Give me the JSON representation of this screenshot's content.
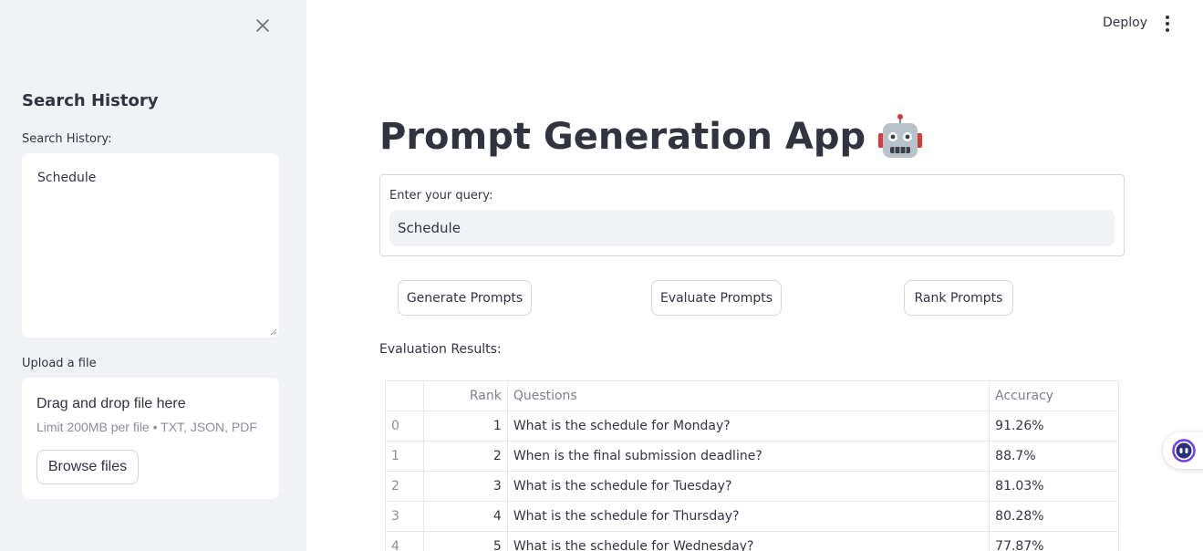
{
  "sidebar": {
    "heading": "Search History",
    "history_label": "Search History:",
    "history_value": "Schedule",
    "upload_label": "Upload a file",
    "upload_title": "Drag and drop file here",
    "upload_limit": "Limit 200MB per file • TXT, JSON, PDF",
    "browse_label": "Browse files"
  },
  "header": {
    "deploy_label": "Deploy"
  },
  "main": {
    "title": "Prompt Generation App",
    "query_label": "Enter your query:",
    "query_value": "Schedule",
    "buttons": {
      "generate": "Generate Prompts",
      "evaluate": "Evaluate Prompts",
      "rank": "Rank Prompts"
    },
    "results_label": "Evaluation Results:",
    "table": {
      "headers": [
        "",
        "Rank",
        "Questions",
        "Accuracy"
      ],
      "rows": [
        {
          "index": "0",
          "rank": "1",
          "question": "What is the schedule for Monday?",
          "accuracy": "91.26%"
        },
        {
          "index": "1",
          "rank": "2",
          "question": "When is the final submission deadline?",
          "accuracy": "88.7%"
        },
        {
          "index": "2",
          "rank": "3",
          "question": "What is the schedule for Tuesday?",
          "accuracy": "81.03%"
        },
        {
          "index": "3",
          "rank": "4",
          "question": "What is the schedule for Thursday?",
          "accuracy": "80.28%"
        },
        {
          "index": "4",
          "rank": "5",
          "question": "What is the schedule for Wednesday?",
          "accuracy": "77.87%"
        }
      ]
    }
  },
  "colors": {
    "sidebar_bg": "#f0f2f6",
    "text": "#31333f",
    "muted": "#8a8d97",
    "border": "#d3d5da",
    "assistant_accent": "#6c3df2"
  },
  "icons": {
    "close": "close-icon",
    "menu": "more-vertical-icon",
    "title_emoji": "robot-icon",
    "assistant": "assistant-icon"
  }
}
